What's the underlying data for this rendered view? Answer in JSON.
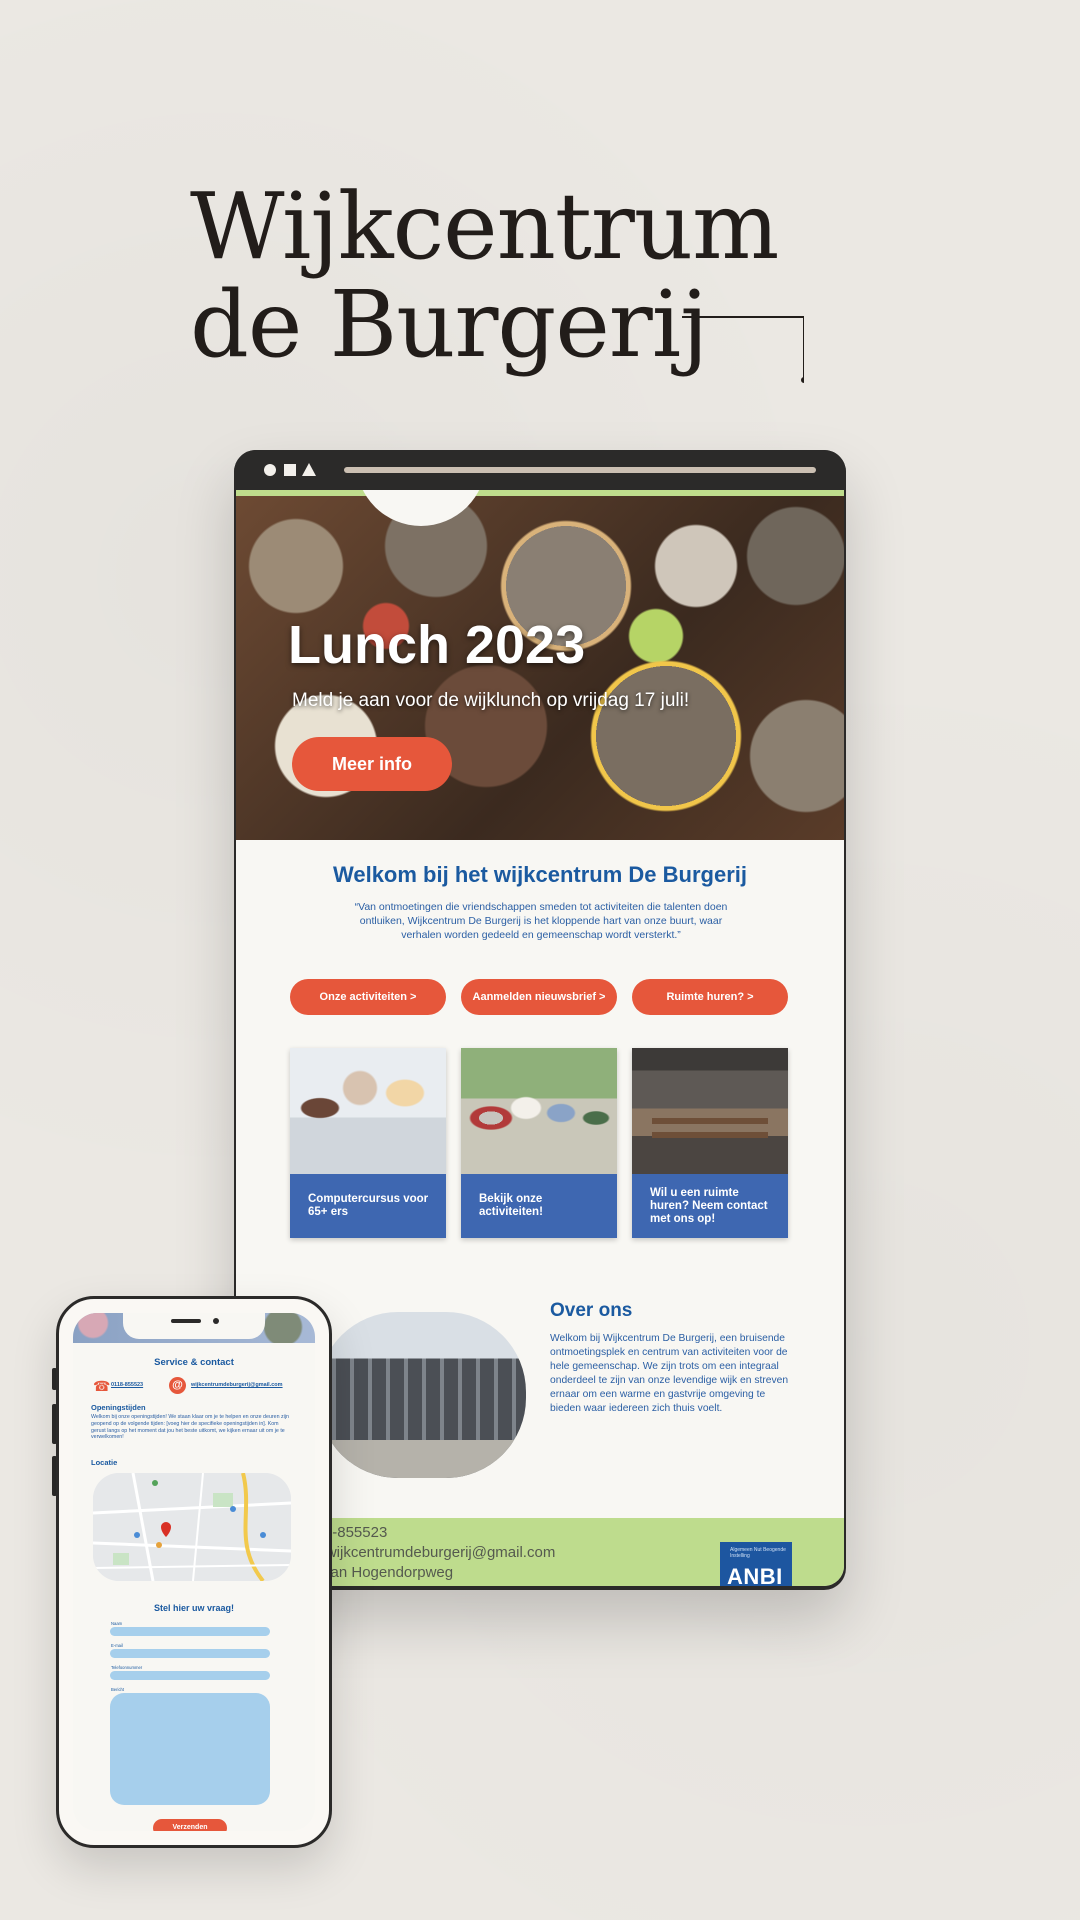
{
  "headline": {
    "line1": "Wijkcentrum",
    "line2": "de Burgerij"
  },
  "tablet": {
    "hero": {
      "title": "Lunch 2023",
      "subtitle": "Meld je aan voor de wijklunch op vrijdag 17 juli!",
      "button": "Meer info"
    },
    "welcome_title": "Welkom bij het wijkcentrum De Burgerij",
    "quote": "“Van ontmoetingen die vriendschappen smeden tot activiteiten die talenten doen ontluiken, Wijkcentrum De Burgerij is het kloppende hart van onze buurt, waar verhalen worden gedeeld en gemeenschap wordt versterkt.”",
    "buttons": [
      "Onze activiteiten >",
      "Aanmelden nieuwsbrief >",
      "Ruimte huren? >"
    ],
    "cards": [
      "Computercursus voor 65+ ers",
      "Bekijk onze activiteiten!",
      "Wil u een ruimte huren? Neem contact met ons op!"
    ],
    "about": {
      "title": "Over ons",
      "text": "Welkom bij Wijkcentrum De Burgerij, een bruisende ontmoetingsplek en centrum van activiteiten voor de hele gemeenschap. We zijn trots om een integraal onderdeel te zijn van onze levendige wijk en streven ernaar om een warme en gastvrije omgeving te bieden waar iedereen zich thuis voelt."
    },
    "footer": {
      "phone": "0118-855523",
      "email": "Email: wijkcentrumdeburgerij@gmail.com",
      "address": "Adress: van Hogendorpweg",
      "anbi_small": "Algemeen Nut Beogende Instelling",
      "anbi": "ANBI"
    }
  },
  "phone": {
    "service_title": "Service & contact",
    "phone_number": "0118-855523",
    "email": "wijkcentrumdeburgerij@gmail.com",
    "hours_title": "Openingstijden",
    "hours_text": "Welkom bij onze openingstijden! We staan klaar om je te helpen en onze deuren zijn geopend op de volgende tijden: [voeg hier de specifieke openingstijden in]. Kom gerust langs op het moment dat jou het beste uitkomt, we kijken ernaar uit om je te verwelkomen!",
    "location_title": "Locatie",
    "form_title": "Stel hier uw vraag!",
    "labels": [
      "Naam",
      "E-mail",
      "Telefoonnummer",
      "Bericht"
    ],
    "send_button": "Verzenden"
  },
  "colors": {
    "accent": "#e6573b",
    "brand_blue": "#1b5aa0",
    "green": "#bedc8d",
    "card_blue": "#3e67b1"
  }
}
